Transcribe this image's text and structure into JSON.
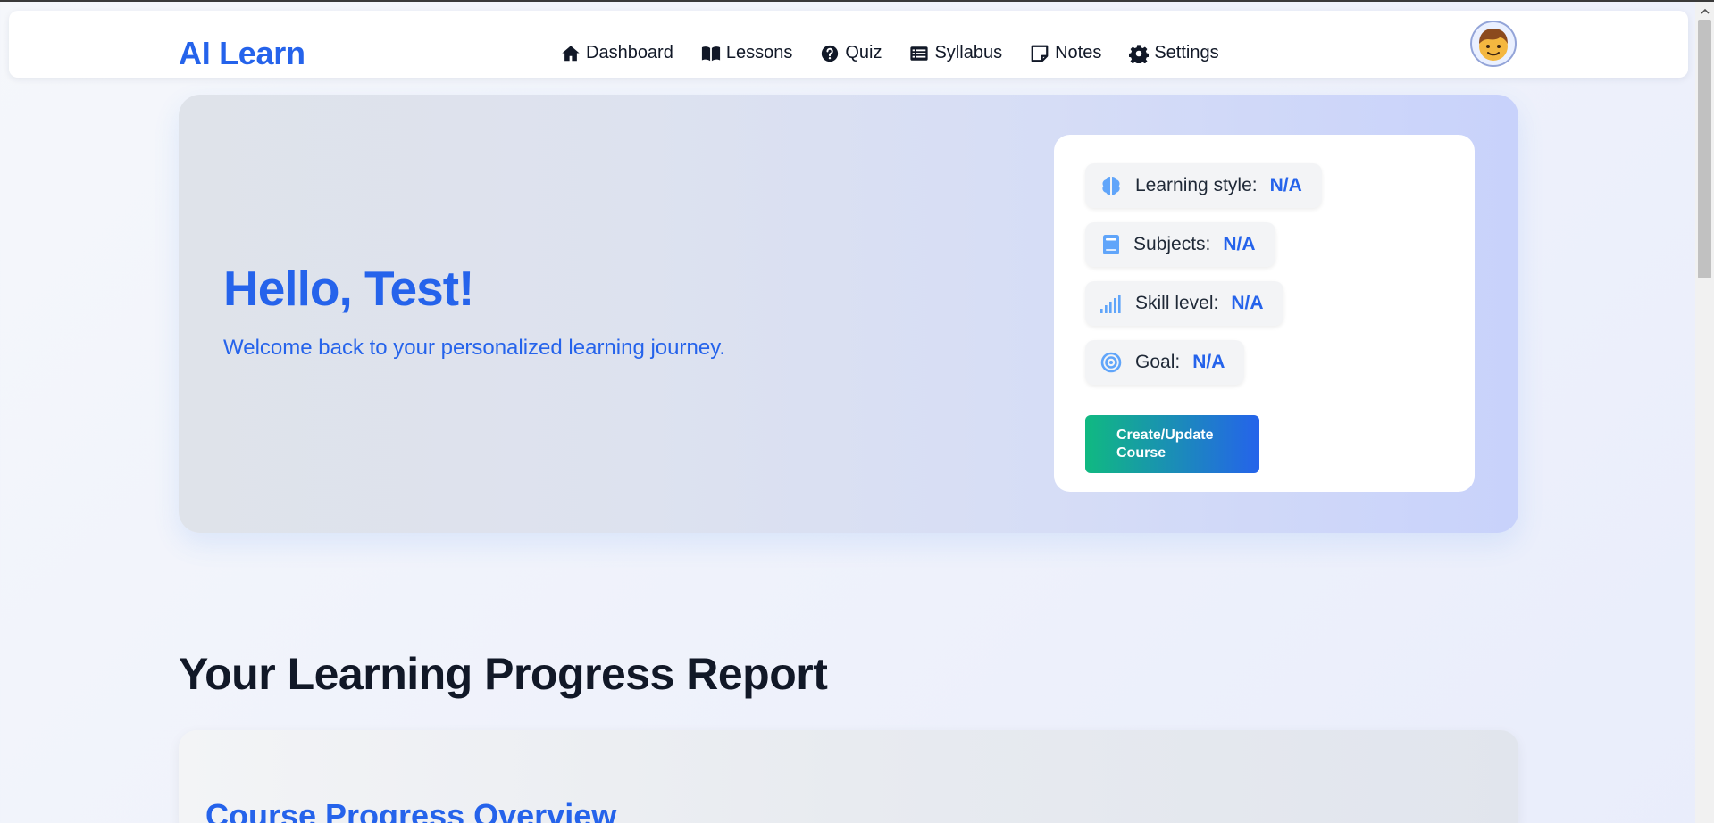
{
  "app": {
    "brand": "AI Learn"
  },
  "nav": {
    "items": [
      {
        "label": "Dashboard",
        "icon": "home-icon"
      },
      {
        "label": "Lessons",
        "icon": "book-open-icon"
      },
      {
        "label": "Quiz",
        "icon": "question-circle-icon"
      },
      {
        "label": "Syllabus",
        "icon": "list-icon"
      },
      {
        "label": "Notes",
        "icon": "sticky-note-icon"
      },
      {
        "label": "Settings",
        "icon": "gear-icon"
      }
    ],
    "avatar": "boy-face-avatar"
  },
  "hero": {
    "greeting": "Hello, Test!",
    "subtitle": "Welcome back to your personalized learning journey."
  },
  "profile": {
    "items": [
      {
        "label": "Learning style:",
        "value": "N/A",
        "icon": "brain-icon"
      },
      {
        "label": "Subjects:",
        "value": "N/A",
        "icon": "book-icon"
      },
      {
        "label": "Skill level:",
        "value": "N/A",
        "icon": "signal-bars-icon"
      },
      {
        "label": "Goal:",
        "value": "N/A",
        "icon": "target-icon"
      }
    ],
    "button_line1": "Create/Update",
    "button_line2": "Course"
  },
  "progress": {
    "section_title": "Your Learning Progress Report",
    "card_title": "Course Progress Overview"
  },
  "colors": {
    "brand": "#2563eb",
    "button_gradient_start": "#10b981",
    "button_gradient_end": "#2563eb",
    "icon_blue": "#60a5fa"
  }
}
